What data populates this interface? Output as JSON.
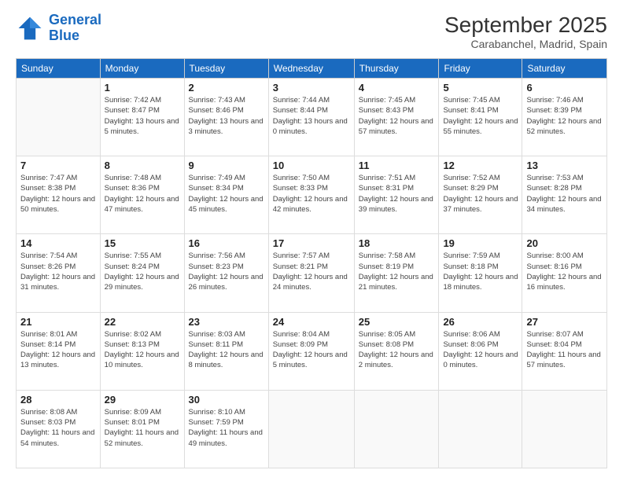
{
  "header": {
    "logo_line1": "General",
    "logo_line2": "Blue",
    "month": "September 2025",
    "location": "Carabanchel, Madrid, Spain"
  },
  "weekdays": [
    "Sunday",
    "Monday",
    "Tuesday",
    "Wednesday",
    "Thursday",
    "Friday",
    "Saturday"
  ],
  "weeks": [
    [
      {
        "day": "",
        "empty": true
      },
      {
        "day": "1",
        "sunrise": "7:42 AM",
        "sunset": "8:47 PM",
        "daylight": "13 hours and 5 minutes."
      },
      {
        "day": "2",
        "sunrise": "7:43 AM",
        "sunset": "8:46 PM",
        "daylight": "13 hours and 3 minutes."
      },
      {
        "day": "3",
        "sunrise": "7:44 AM",
        "sunset": "8:44 PM",
        "daylight": "13 hours and 0 minutes."
      },
      {
        "day": "4",
        "sunrise": "7:45 AM",
        "sunset": "8:43 PM",
        "daylight": "12 hours and 57 minutes."
      },
      {
        "day": "5",
        "sunrise": "7:45 AM",
        "sunset": "8:41 PM",
        "daylight": "12 hours and 55 minutes."
      },
      {
        "day": "6",
        "sunrise": "7:46 AM",
        "sunset": "8:39 PM",
        "daylight": "12 hours and 52 minutes."
      }
    ],
    [
      {
        "day": "7",
        "sunrise": "7:47 AM",
        "sunset": "8:38 PM",
        "daylight": "12 hours and 50 minutes."
      },
      {
        "day": "8",
        "sunrise": "7:48 AM",
        "sunset": "8:36 PM",
        "daylight": "12 hours and 47 minutes."
      },
      {
        "day": "9",
        "sunrise": "7:49 AM",
        "sunset": "8:34 PM",
        "daylight": "12 hours and 45 minutes."
      },
      {
        "day": "10",
        "sunrise": "7:50 AM",
        "sunset": "8:33 PM",
        "daylight": "12 hours and 42 minutes."
      },
      {
        "day": "11",
        "sunrise": "7:51 AM",
        "sunset": "8:31 PM",
        "daylight": "12 hours and 39 minutes."
      },
      {
        "day": "12",
        "sunrise": "7:52 AM",
        "sunset": "8:29 PM",
        "daylight": "12 hours and 37 minutes."
      },
      {
        "day": "13",
        "sunrise": "7:53 AM",
        "sunset": "8:28 PM",
        "daylight": "12 hours and 34 minutes."
      }
    ],
    [
      {
        "day": "14",
        "sunrise": "7:54 AM",
        "sunset": "8:26 PM",
        "daylight": "12 hours and 31 minutes."
      },
      {
        "day": "15",
        "sunrise": "7:55 AM",
        "sunset": "8:24 PM",
        "daylight": "12 hours and 29 minutes."
      },
      {
        "day": "16",
        "sunrise": "7:56 AM",
        "sunset": "8:23 PM",
        "daylight": "12 hours and 26 minutes."
      },
      {
        "day": "17",
        "sunrise": "7:57 AM",
        "sunset": "8:21 PM",
        "daylight": "12 hours and 24 minutes."
      },
      {
        "day": "18",
        "sunrise": "7:58 AM",
        "sunset": "8:19 PM",
        "daylight": "12 hours and 21 minutes."
      },
      {
        "day": "19",
        "sunrise": "7:59 AM",
        "sunset": "8:18 PM",
        "daylight": "12 hours and 18 minutes."
      },
      {
        "day": "20",
        "sunrise": "8:00 AM",
        "sunset": "8:16 PM",
        "daylight": "12 hours and 16 minutes."
      }
    ],
    [
      {
        "day": "21",
        "sunrise": "8:01 AM",
        "sunset": "8:14 PM",
        "daylight": "12 hours and 13 minutes."
      },
      {
        "day": "22",
        "sunrise": "8:02 AM",
        "sunset": "8:13 PM",
        "daylight": "12 hours and 10 minutes."
      },
      {
        "day": "23",
        "sunrise": "8:03 AM",
        "sunset": "8:11 PM",
        "daylight": "12 hours and 8 minutes."
      },
      {
        "day": "24",
        "sunrise": "8:04 AM",
        "sunset": "8:09 PM",
        "daylight": "12 hours and 5 minutes."
      },
      {
        "day": "25",
        "sunrise": "8:05 AM",
        "sunset": "8:08 PM",
        "daylight": "12 hours and 2 minutes."
      },
      {
        "day": "26",
        "sunrise": "8:06 AM",
        "sunset": "8:06 PM",
        "daylight": "12 hours and 0 minutes."
      },
      {
        "day": "27",
        "sunrise": "8:07 AM",
        "sunset": "8:04 PM",
        "daylight": "11 hours and 57 minutes."
      }
    ],
    [
      {
        "day": "28",
        "sunrise": "8:08 AM",
        "sunset": "8:03 PM",
        "daylight": "11 hours and 54 minutes."
      },
      {
        "day": "29",
        "sunrise": "8:09 AM",
        "sunset": "8:01 PM",
        "daylight": "11 hours and 52 minutes."
      },
      {
        "day": "30",
        "sunrise": "8:10 AM",
        "sunset": "7:59 PM",
        "daylight": "11 hours and 49 minutes."
      },
      {
        "day": "",
        "empty": true
      },
      {
        "day": "",
        "empty": true
      },
      {
        "day": "",
        "empty": true
      },
      {
        "day": "",
        "empty": true
      }
    ]
  ]
}
